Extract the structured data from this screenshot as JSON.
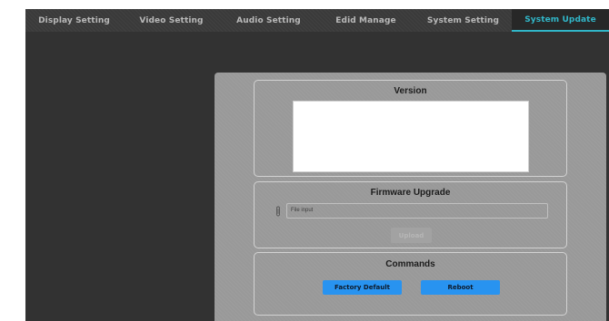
{
  "tabs": [
    {
      "label": "Display Setting",
      "active": false
    },
    {
      "label": "Video Setting",
      "active": false
    },
    {
      "label": "Audio Setting",
      "active": false
    },
    {
      "label": "Edid Manage",
      "active": false
    },
    {
      "label": "System Setting",
      "active": false
    },
    {
      "label": "System Update",
      "active": true
    }
  ],
  "version": {
    "title": "Version",
    "text": ""
  },
  "firmware": {
    "title": "Firmware Upgrade",
    "file_input_placeholder": "File input",
    "upload_label": "Upload",
    "icon": "paperclip-icon"
  },
  "commands": {
    "title": "Commands",
    "factory_default_label": "Factory Default",
    "reboot_label": "Reboot"
  },
  "colors": {
    "accent": "#31b7c9",
    "button_blue": "#2893f0",
    "panel": "#999999",
    "background": "#323232"
  }
}
